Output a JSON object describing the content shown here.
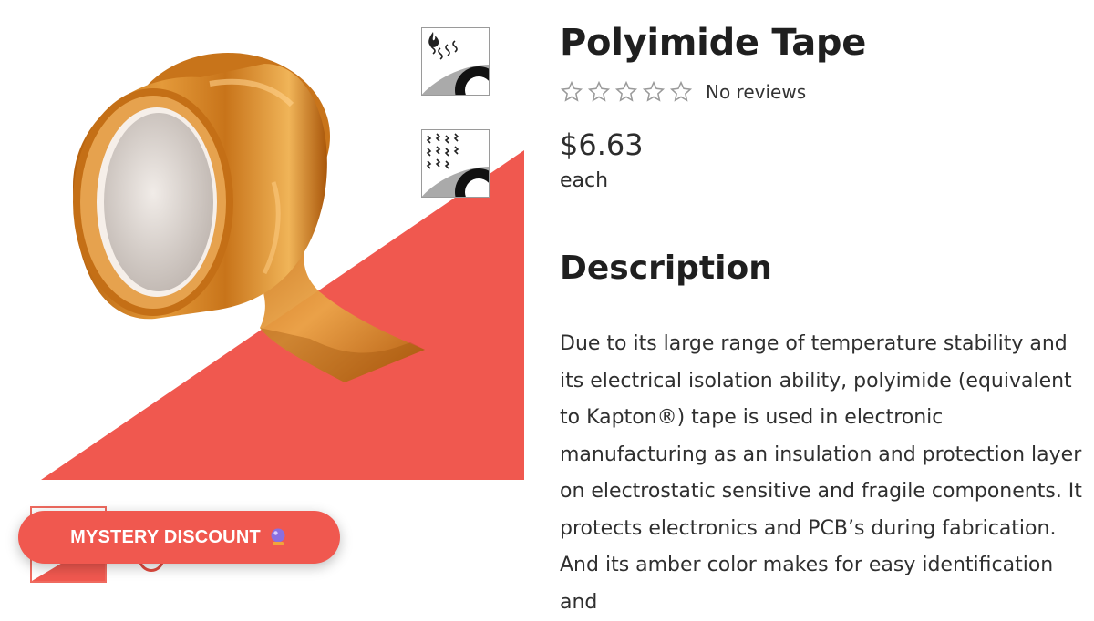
{
  "product": {
    "title": "Polyimide Tape",
    "rating_value": 0,
    "rating_max": 5,
    "reviews_text": "No reviews",
    "price": "$6.63",
    "unit": "each"
  },
  "description": {
    "heading": "Description",
    "paragraphs": [
      "Due to its large range of temperature stability and its electrical isolation ability, polyimide (equivalent to Kapton®) tape is used in electronic manufacturing as an insulation and protection layer on electrostatic sensitive and fragile components. It",
      "protects electronics and PCB’s during fabrication. And its amber color makes for easy identification and"
    ]
  },
  "gallery": {
    "main_image_icon": "amber-tape-roll-image",
    "thumbnails": [
      {
        "icon": "heat-resistance-icon"
      },
      {
        "icon": "electrostatic-protection-icon"
      }
    ]
  },
  "promo": {
    "label": "MYSTERY DISCOUNT",
    "icon": "crystal-ball-icon"
  },
  "colors": {
    "accent": "#f0584f",
    "amber": "#c8741a",
    "text": "#2b2b2b"
  }
}
